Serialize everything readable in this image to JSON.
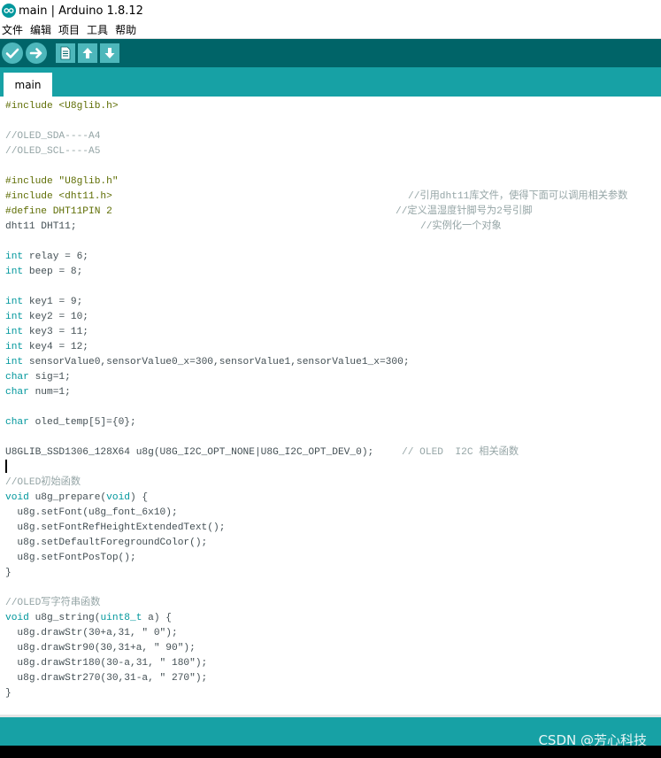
{
  "window": {
    "title": "main | Arduino 1.8.12"
  },
  "menu": [
    "文件",
    "编辑",
    "项目",
    "工具",
    "帮助"
  ],
  "toolbar": {
    "buttons": [
      {
        "name": "verify-button",
        "icon": "check-icon"
      },
      {
        "name": "upload-button",
        "icon": "arrow-right-icon"
      },
      {
        "name": "new-button",
        "icon": "new-file-icon"
      },
      {
        "name": "open-button",
        "icon": "arrow-up-icon"
      },
      {
        "name": "save-button",
        "icon": "arrow-down-icon"
      }
    ]
  },
  "tabs": [
    {
      "label": "main"
    }
  ],
  "code": {
    "l1": "#include <U8glib.h>",
    "l3": "//OLED_SDA----A4",
    "l4": "//OLED_SCL----A5",
    "l6": "#include \"U8glib.h\"",
    "l7": "#include <dht11.h>",
    "l7c": "//引用dht11库文件，使得下面可以调用相关参数",
    "l8": "#define DHT11PIN 2",
    "l8c": "//定义温湿度针脚号为2号引脚",
    "l9": "dht11 DHT11;",
    "l9c": "//实例化一个对象",
    "l11a": "int",
    "l11b": " relay = 6;",
    "l12a": "int",
    "l12b": " beep = 8;",
    "l14a": "int",
    "l14b": " key1 = 9;",
    "l15a": "int",
    "l15b": " key2 = 10;",
    "l16a": "int",
    "l16b": " key3 = 11;",
    "l17a": "int",
    "l17b": " key4 = 12;",
    "l18a": "int",
    "l18b": " sensorValue0,sensorValue0_x=300,sensorValue1,sensorValue1_x=300;",
    "l19a": "char",
    "l19b": " sig=1;",
    "l20a": "char",
    "l20b": " num=1;",
    "l22a": "char",
    "l22b": " oled_temp[5]={0};",
    "l24": "U8GLIB_SSD1306_128X64 u8g(U8G_I2C_OPT_NONE|U8G_I2C_OPT_DEV_0);",
    "l24c": "// OLED  I2C 相关函数",
    "l26": "//OLED初始函数",
    "l27a": "void",
    "l27b": " u8g_prepare(",
    "l27c": "void",
    "l27d": ") {",
    "l28": "  u8g.setFont(u8g_font_6x10);",
    "l29": "  u8g.setFontRefHeightExtendedText();",
    "l30": "  u8g.setDefaultForegroundColor();",
    "l31": "  u8g.setFontPosTop();",
    "l32": "}",
    "l34": "//OLED写字符串函数",
    "l35a": "void",
    "l35b": " u8g_string(",
    "l35c": "uint8_t",
    "l35d": " a) {",
    "l36": "  u8g.drawStr(30+a,31, \" 0\");",
    "l37": "  u8g.drawStr90(30,31+a, \" 90\");",
    "l38": "  u8g.drawStr180(30-a,31, \" 180\");",
    "l39": "  u8g.drawStr270(30,31-a, \" 270\");",
    "l40": "}"
  },
  "watermark": "CSDN @芳心科技",
  "colors": {
    "toolbar": "#006468",
    "tabbar": "#17a1a5",
    "keyword": "#00979c",
    "comment": "#95a5a6",
    "preprocessor": "#5e6d03"
  }
}
